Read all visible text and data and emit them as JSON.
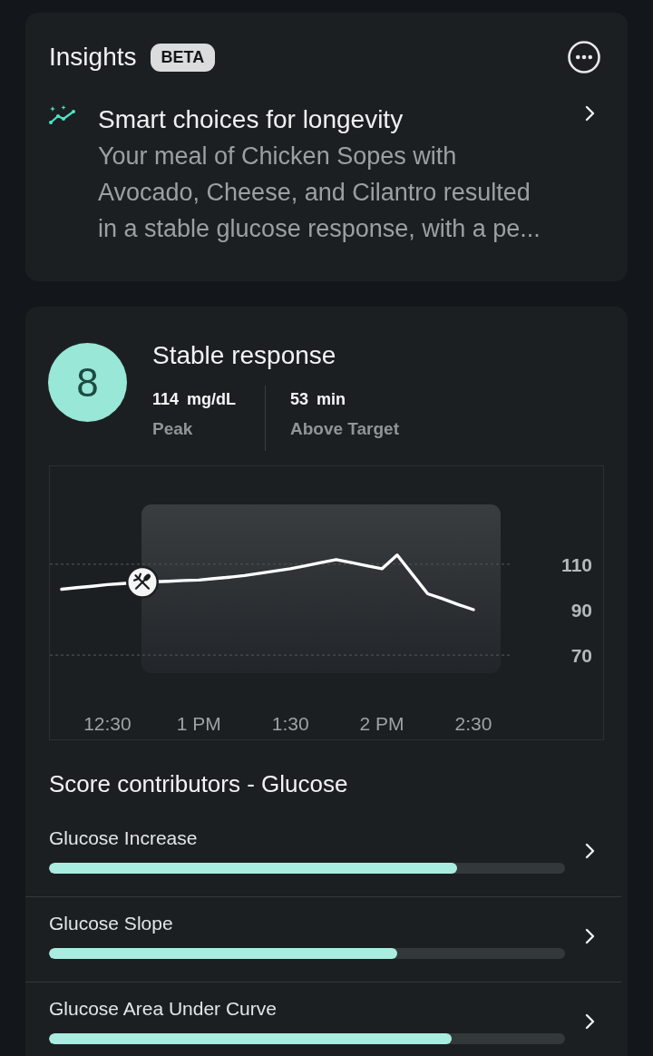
{
  "insights": {
    "title": "Insights",
    "badge": "BETA",
    "items": [
      {
        "title": "Smart choices for longevity",
        "text": "Your meal of Chicken Sopes with Avocado, Cheese, and Cilantro resulted in a stable glucose response, with a pe..."
      }
    ]
  },
  "response": {
    "score": "8",
    "title": "Stable response",
    "stats": [
      {
        "value": "114",
        "unit": "mg/dL",
        "label": "Peak"
      },
      {
        "value": "53",
        "unit": "min",
        "label": "Above Target"
      }
    ],
    "chart_data": {
      "type": "line",
      "categories": [
        null,
        null,
        null,
        "12:30",
        null,
        null,
        null,
        null,
        null,
        "1 PM",
        null,
        null,
        null,
        null,
        null,
        "1:30",
        null,
        null,
        null,
        null,
        null,
        "2 PM",
        null,
        null,
        null,
        null,
        null,
        "2:30"
      ],
      "values": [
        99,
        99.7,
        100.3,
        101,
        101.5,
        102,
        102.3,
        102.5,
        102.8,
        103,
        103.7,
        104.3,
        105,
        106,
        107,
        108,
        109.3,
        110.7,
        112,
        110.7,
        109.3,
        108,
        114,
        105.5,
        97,
        94.7,
        92.3,
        90
      ],
      "ylim": [
        33,
        153
      ],
      "yticks": [
        70,
        90,
        110
      ],
      "ref_lines": [
        {
          "axis": "y",
          "value": 110
        },
        {
          "axis": "y",
          "value": 70
        }
      ]
    }
  },
  "score_contributors": {
    "title": "Score contributors - Glucose",
    "items": [
      {
        "label": "Glucose Increase",
        "level": 0.79
      },
      {
        "label": "Glucose Slope",
        "level": 0.675
      },
      {
        "label": "Glucose Area Under Curve",
        "level": 0.78
      }
    ]
  }
}
